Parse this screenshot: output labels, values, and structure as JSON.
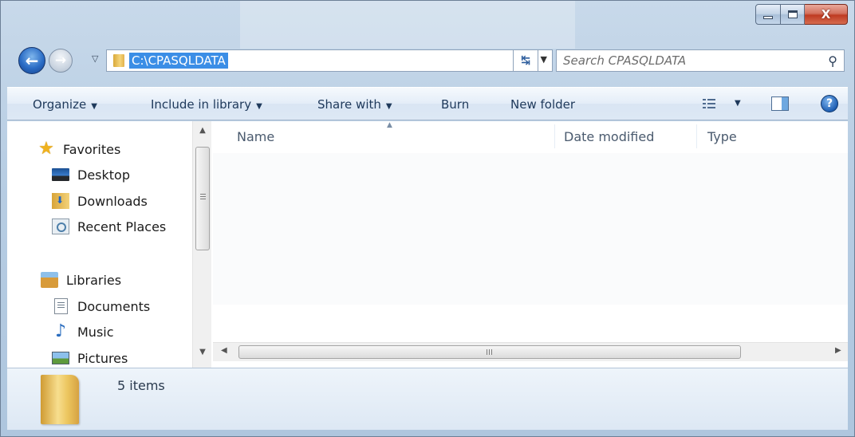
{
  "window": {
    "caption": {
      "minimize": "",
      "maximize": "",
      "close": "X"
    }
  },
  "navigation": {
    "back": "←",
    "forward": "→",
    "address": "C:\\CPASQLDATA",
    "search_placeholder": "Search CPASQLDATA"
  },
  "toolbar": {
    "organize": "Organize",
    "include_in_library": "Include in library",
    "share_with": "Share with",
    "burn": "Burn",
    "new_folder": "New folder",
    "help": "?"
  },
  "sidebar": {
    "favorites": {
      "label": "Favorites",
      "icon": "star-icon"
    },
    "favorite_items": [
      {
        "label": "Desktop",
        "icon": "desktop-icon"
      },
      {
        "label": "Downloads",
        "icon": "downloads-icon"
      },
      {
        "label": "Recent Places",
        "icon": "recent-places-icon"
      }
    ],
    "libraries": {
      "label": "Libraries",
      "icon": "libraries-icon"
    },
    "library_items": [
      {
        "label": "Documents",
        "icon": "documents-icon"
      },
      {
        "label": "Music",
        "icon": "music-icon"
      },
      {
        "label": "Pictures",
        "icon": "pictures-icon"
      }
    ]
  },
  "file_list": {
    "columns": [
      "Name",
      "Date modified",
      "Type"
    ],
    "rows": []
  },
  "scrollbars": {
    "grip": "III"
  },
  "details": {
    "item_count": "5 items"
  }
}
